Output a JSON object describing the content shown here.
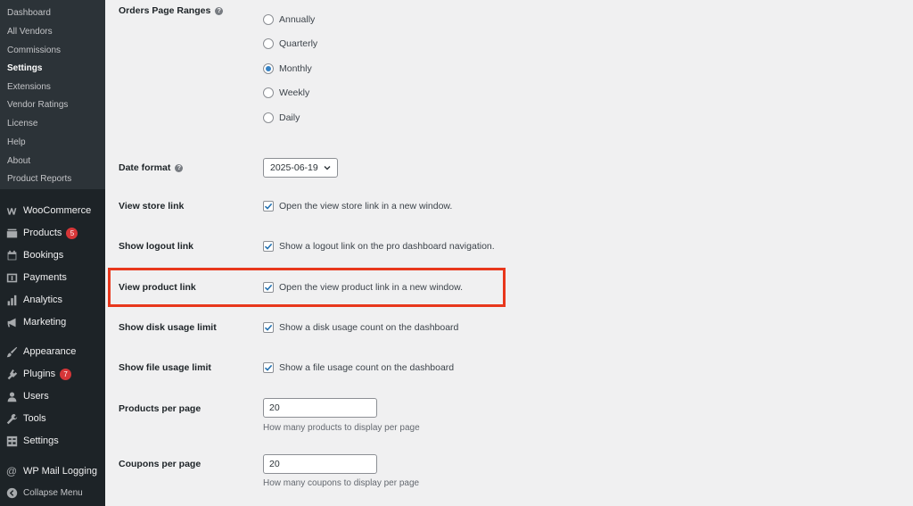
{
  "sidebar": {
    "submenu": [
      "Dashboard",
      "All Vendors",
      "Commissions",
      "Settings",
      "Extensions",
      "Vendor Ratings",
      "License",
      "Help",
      "About",
      "Product Reports"
    ],
    "current_submenu": "Settings",
    "menu": [
      {
        "label": "WooCommerce",
        "icon": "woocommerce-icon"
      },
      {
        "label": "Products",
        "icon": "products-icon",
        "badge": "5"
      },
      {
        "label": "Bookings",
        "icon": "calendar-icon"
      },
      {
        "label": "Payments",
        "icon": "payments-icon"
      },
      {
        "label": "Analytics",
        "icon": "analytics-icon"
      },
      {
        "label": "Marketing",
        "icon": "megaphone-icon"
      },
      {
        "label": "Appearance",
        "icon": "paintbrush-icon"
      },
      {
        "label": "Plugins",
        "icon": "plugin-icon",
        "badge": "7"
      },
      {
        "label": "Users",
        "icon": "users-icon"
      },
      {
        "label": "Tools",
        "icon": "wrench-icon"
      },
      {
        "label": "Settings",
        "icon": "settings-icon"
      },
      {
        "label": "WP Mail Logging",
        "icon": "at-icon"
      }
    ],
    "collapse_label": "Collapse Menu"
  },
  "settings": {
    "orders_page_ranges": {
      "label": "Orders Page Ranges",
      "options": [
        "Annually",
        "Quarterly",
        "Monthly",
        "Weekly",
        "Daily"
      ],
      "selected": "Monthly"
    },
    "date_format": {
      "label": "Date format",
      "value": "2025-06-19"
    },
    "view_store_link": {
      "label": "View store link",
      "text": "Open the view store link in a new window.",
      "checked": true
    },
    "show_logout_link": {
      "label": "Show logout link",
      "text": "Show a logout link on the pro dashboard navigation.",
      "checked": true
    },
    "view_product_link": {
      "label": "View product link",
      "text": "Open the view product link in a new window.",
      "checked": true
    },
    "show_disk_usage_limit": {
      "label": "Show disk usage limit",
      "text": "Show a disk usage count on the dashboard",
      "checked": true
    },
    "show_file_usage_limit": {
      "label": "Show file usage limit",
      "text": "Show a file usage count on the dashboard",
      "checked": true
    },
    "products_per_page": {
      "label": "Products per page",
      "value": "20",
      "description": "How many products to display per page"
    },
    "coupons_per_page": {
      "label": "Coupons per page",
      "value": "20",
      "description": "How many coupons to display per page"
    }
  },
  "colors": {
    "sidebar_bg": "#1d2327",
    "highlight": "#e8371c",
    "accent": "#2271b1",
    "badge": "#d63638"
  }
}
